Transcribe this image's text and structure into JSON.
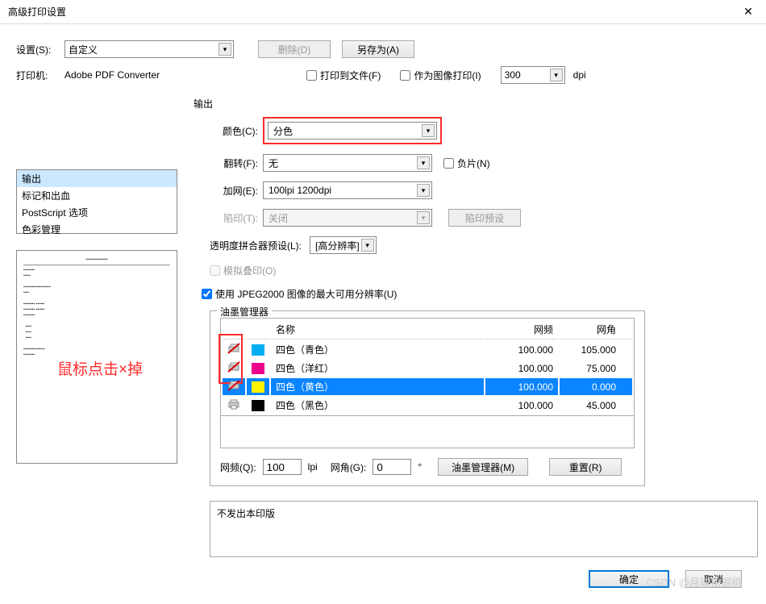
{
  "title": "高级打印设置",
  "settings_label": "设置(S):",
  "settings_value": "自定义",
  "delete_btn": "删除(D)",
  "saveas_btn": "另存为(A)",
  "printer_label": "打印机:",
  "printer_value": "Adobe PDF Converter",
  "print_to_file": "打印到文件(F)",
  "print_as_image": "作为图像打印(I)",
  "dpi_value": "300",
  "dpi_unit": "dpi",
  "sidebar": {
    "items": [
      "输出",
      "标记和出血",
      "PostScript 选项",
      "色彩管理"
    ],
    "selected": 0
  },
  "output_label": "输出",
  "color_label": "颜色(C):",
  "color_value": "分色",
  "flip_label": "翻转(F):",
  "flip_value": "无",
  "negative": "负片(N)",
  "screening_label": "加网(E):",
  "screening_value": "100lpi 1200dpi",
  "trap_label": "陷印(T):",
  "trap_value": "关闭",
  "trap_preview": "陷印预设",
  "transparency_label": "透明度拼合器预设(L):",
  "transparency_value": "[高分辨率]",
  "simulate_overprint": "模拟叠印(O)",
  "use_jpeg2000": "使用 JPEG2000 图像的最大可用分辨率(U)",
  "ink_manager_label": "油墨管理器",
  "ink_table": {
    "headers": [
      "名称",
      "网频",
      "网角"
    ],
    "rows": [
      {
        "name": "四色（青色）",
        "freq": "100.000",
        "angle": "105.000",
        "color": "#00aeef",
        "disabled": true
      },
      {
        "name": "四色（洋红）",
        "freq": "100.000",
        "angle": "75.000",
        "color": "#ec008c",
        "disabled": true
      },
      {
        "name": "四色（黄色）",
        "freq": "100.000",
        "angle": "0.000",
        "color": "#fff200",
        "disabled": true,
        "selected": true
      },
      {
        "name": "四色（黑色）",
        "freq": "100.000",
        "angle": "45.000",
        "color": "#000000",
        "disabled": false
      }
    ]
  },
  "freq_label": "网频(Q):",
  "freq_value": "100",
  "lpi": "lpi",
  "angle_label": "网角(G):",
  "angle_value": "0",
  "deg": "°",
  "ink_manager_btn": "油墨管理器(M)",
  "reset_btn": "重置(R)",
  "status_text": "不发出本印版",
  "ok_btn": "确定",
  "cancel_btn": "取消",
  "annotation": "鼠标点击×掉",
  "watermark": "CSDN @月球挖掘机"
}
